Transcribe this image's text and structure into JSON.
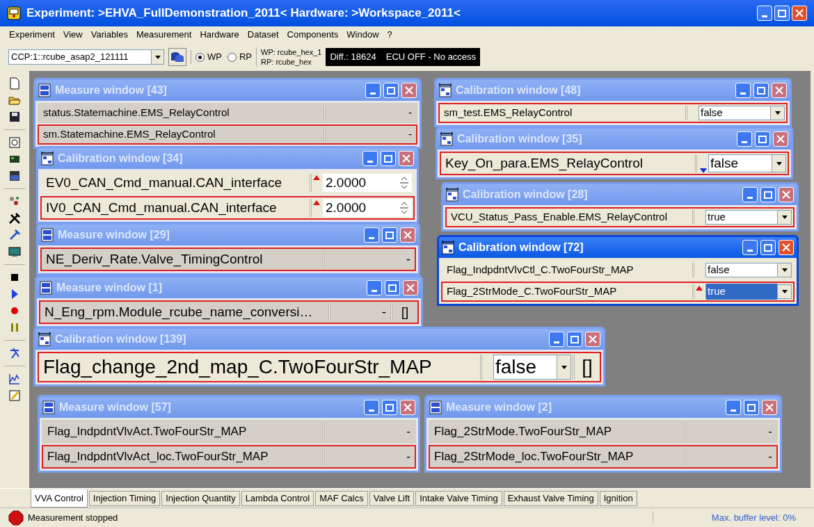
{
  "window": {
    "title": "Experiment: >EHVA_FullDemonstration_2011< Hardware: >Workspace_2011<"
  },
  "menu": [
    "Experiment",
    "View",
    "Variables",
    "Measurement",
    "Hardware",
    "Dataset",
    "Components",
    "Window",
    "?"
  ],
  "toolbar": {
    "device": "CCP:1::rcube_asap2_121111",
    "pages": [
      {
        "label": "WP",
        "selected": true
      },
      {
        "label": "RP",
        "selected": false
      }
    ],
    "wp": "WP: rcube_hex_1",
    "rp": "RP: rcube_hex",
    "diff": "Diff.: 18624",
    "ecu": "ECU OFF - No access"
  },
  "windows": [
    {
      "kind": "measure",
      "title": "Measure window [43]",
      "active": false,
      "rows": [
        {
          "kind": "measure",
          "name": "status.Statemachine.EMS_RelayControl",
          "value": "-",
          "selected": false
        },
        {
          "kind": "measure",
          "name": "sm.Statemachine.EMS_RelayControl",
          "value": "-",
          "selected": true
        }
      ]
    },
    {
      "kind": "calibration",
      "title": "Calibration window [34]",
      "active": false,
      "rows": [
        {
          "kind": "number",
          "name": "EV0_CAN_Cmd_manual.CAN_interface",
          "value": "2.0000",
          "changed": true,
          "below_limit": false,
          "selected": false
        },
        {
          "kind": "number",
          "name": "IV0_CAN_Cmd_manual.CAN_interface",
          "value": "2.0000",
          "changed": true,
          "below_limit": false,
          "selected": true
        }
      ]
    },
    {
      "kind": "measure",
      "title": "Measure window [29]",
      "active": false,
      "rows": [
        {
          "kind": "measure",
          "name": "NE_Deriv_Rate.Valve_TimingControl",
          "value": "-",
          "selected": true
        }
      ]
    },
    {
      "kind": "measure",
      "title": "Measure window [1]",
      "active": false,
      "rows": [
        {
          "kind": "measure",
          "name": "N_Eng_rpm.Module_rcube_name_conversi…",
          "value": "-",
          "extra": "[]",
          "selected": true
        }
      ]
    },
    {
      "kind": "calibration",
      "title": "Calibration window [48]",
      "active": false,
      "rows": [
        {
          "kind": "dropdown",
          "name": "sm_test.EMS_RelayControl",
          "value": "false",
          "changed": false,
          "below_limit": false,
          "selected": true
        }
      ]
    },
    {
      "kind": "calibration",
      "title": "Calibration window [35]",
      "active": false,
      "rows": [
        {
          "kind": "dropdown",
          "name": "Key_On_para.EMS_RelayControl",
          "value": "false",
          "changed": false,
          "below_limit": true,
          "selected": true
        }
      ]
    },
    {
      "kind": "calibration",
      "title": "Calibration window [28]",
      "active": false,
      "rows": [
        {
          "kind": "dropdown",
          "name": "VCU_Status_Pass_Enable.EMS_RelayControl",
          "value": "true",
          "changed": false,
          "below_limit": false,
          "selected": true
        }
      ]
    },
    {
      "kind": "calibration",
      "title": "Calibration window [72]",
      "active": true,
      "rows": [
        {
          "kind": "dropdown",
          "name": "Flag_IndpdntVlvCtl_C.TwoFourStr_MAP",
          "value": "false",
          "changed": false,
          "below_limit": false,
          "selected": false
        },
        {
          "kind": "dropdown",
          "name": "Flag_2StrMode_C.TwoFourStr_MAP",
          "value": "true",
          "changed": true,
          "below_limit": false,
          "selected": true
        }
      ]
    },
    {
      "kind": "calibration",
      "title": "Calibration window [139]",
      "active": false,
      "rows": [
        {
          "kind": "dropdown",
          "name": "Flag_change_2nd_map_C.TwoFourStr_MAP",
          "value": "false",
          "extra": "[]",
          "changed": false,
          "below_limit": false,
          "selected": true
        }
      ]
    },
    {
      "kind": "measure",
      "title": "Measure window [57]",
      "active": false,
      "rows": [
        {
          "kind": "measure",
          "name": "Flag_IndpdntVlvAct.TwoFourStr_MAP",
          "value": "-",
          "selected": false
        },
        {
          "kind": "measure",
          "name": "Flag_IndpdntVlvAct_loc.TwoFourStr_MAP",
          "value": "-",
          "selected": true
        }
      ]
    },
    {
      "kind": "measure",
      "title": "Measure window [2]",
      "active": false,
      "rows": [
        {
          "kind": "measure",
          "name": "Flag_2StrMode.TwoFourStr_MAP",
          "value": "-",
          "selected": false
        },
        {
          "kind": "measure",
          "name": "Flag_2StrMode_loc.TwoFourStr_MAP",
          "value": "-",
          "selected": true
        }
      ]
    }
  ],
  "tabs": [
    {
      "label": "VVA Control",
      "selected": true
    },
    {
      "label": "Injection Timing",
      "selected": false
    },
    {
      "label": "Injection Quantity",
      "selected": false
    },
    {
      "label": "Lambda Control",
      "selected": false
    },
    {
      "label": "MAF Calcs",
      "selected": false
    },
    {
      "label": "Valve Lift",
      "selected": false
    },
    {
      "label": "Intake Valve Timing",
      "selected": false
    },
    {
      "label": "Exhaust Valve Timing",
      "selected": false
    },
    {
      "label": "Ignition",
      "selected": false
    }
  ],
  "status_bar": {
    "message": "Measurement stopped",
    "buffer": "Max. buffer level: 0%"
  }
}
